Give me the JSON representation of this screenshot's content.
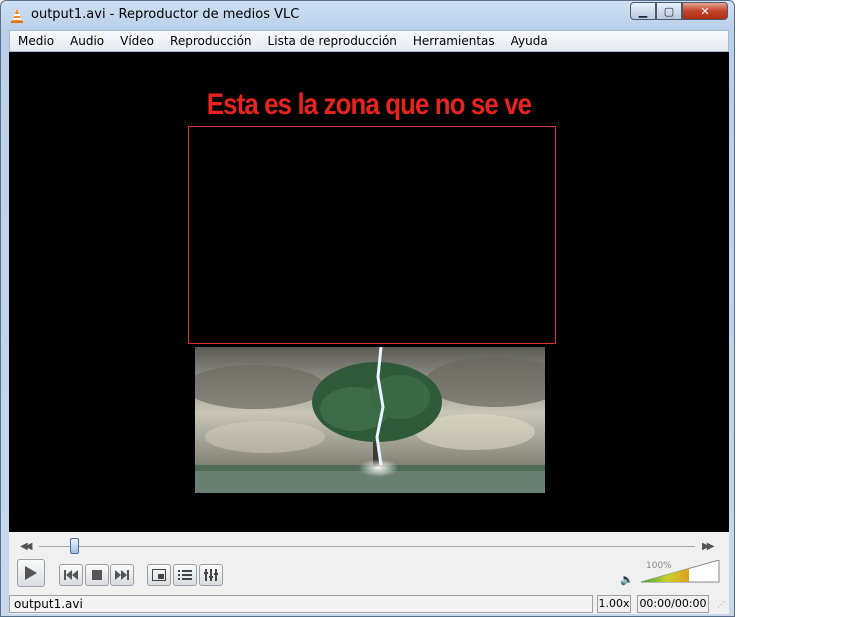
{
  "window": {
    "title": "output1.avi - Reproductor de medios VLC"
  },
  "window_controls": {
    "minimize": "▁",
    "maximize": "▢",
    "close": "✕"
  },
  "menu": [
    {
      "label": "Medio"
    },
    {
      "label": "Audio"
    },
    {
      "label": "Vídeo"
    },
    {
      "label": "Reproducción"
    },
    {
      "label": "Lista de reproducción"
    },
    {
      "label": "Herramientas"
    },
    {
      "label": "Ayuda"
    }
  ],
  "video": {
    "annotation": "Esta es la zona que no se ve",
    "annotation_color": "#e8231f"
  },
  "controls": {
    "seek_position": 0.06,
    "volume_label": "100%",
    "volume_level": 1.0,
    "icons": [
      "play-icon",
      "previous-icon",
      "stop-icon",
      "next-icon",
      "fullscreen-icon",
      "playlist-icon",
      "extended-settings-icon",
      "speaker-icon"
    ]
  },
  "status": {
    "filename": "output1.avi",
    "speed": "1.00x",
    "time": "00:00/00:00"
  }
}
